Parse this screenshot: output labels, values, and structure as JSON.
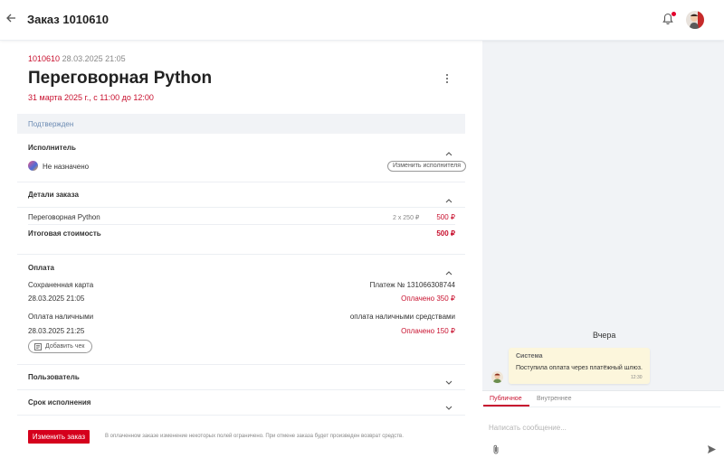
{
  "header": {
    "title": "Заказ 1010610",
    "back_icon": "arrow-left-icon",
    "bell_icon": "bell-icon",
    "accent": "#e3002b"
  },
  "order": {
    "number": "1010610",
    "created": "28.03.2025 21:05",
    "title": "Переговорная Python",
    "schedule": "31 марта 2025 г., с 11:00 до 12:00",
    "status": "Подтвержден"
  },
  "executor": {
    "section_title": "Исполнитель",
    "assignee": "Не назначено",
    "change_button": "Изменить исполнителя"
  },
  "details": {
    "section_title": "Детали заказа",
    "item_name": "Переговорная Python",
    "item_qty": "2 x 250 ₽",
    "item_price": "500 ₽",
    "total_label": "Итоговая стоимость",
    "total_value": "500 ₽"
  },
  "payment": {
    "section_title": "Оплата",
    "p1_method": "Сохраненная карта",
    "p1_ref": "Платеж № 131066308744",
    "p1_date": "28.03.2025 21:05",
    "p1_status": "Оплачено 350 ₽",
    "p2_method": "Оплата наличными",
    "p2_ref": "оплата наличными средствами",
    "p2_date": "28.03.2025 21:25",
    "p2_status": "Оплачено 150 ₽",
    "receipt_button": "Добавить чек"
  },
  "user_section": {
    "title": "Пользователь"
  },
  "deadline_section": {
    "title": "Срок исполнения"
  },
  "footer": {
    "change_order_button": "Изменить заказ",
    "note": "В оплаченном заказе изменение некоторых полей ограничено. При отмене заказа будет произведен возврат средств."
  },
  "chat": {
    "day_label": "Вчера",
    "message": {
      "author": "Система",
      "text": "Поступила оплата через платёжный шлюз.",
      "time": "12:30"
    },
    "tabs": {
      "public": "Публичное",
      "internal": "Внутреннее"
    },
    "input_placeholder": "Написать сообщение..."
  },
  "colors": {
    "red": "#c8102e",
    "status_blue": "#6c8bb3",
    "panel_bg": "#f1f3f6",
    "bubble_bg": "#fcf6dc"
  }
}
